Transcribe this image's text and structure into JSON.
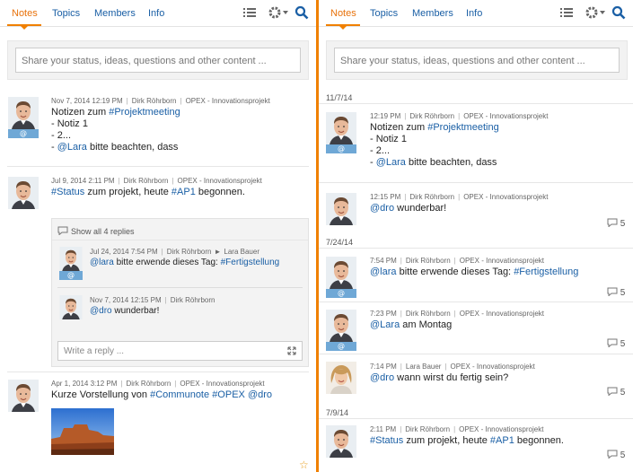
{
  "tabs": [
    "Notes",
    "Topics",
    "Members",
    "Info"
  ],
  "share_placeholder": "Share your status, ideas, questions and other content ...",
  "colors": {
    "accent": "#f08000",
    "link": "#1a5fa5",
    "badge": "#6fa8d6"
  },
  "left": {
    "posts": [
      {
        "date": "Nov 7, 2014 12:19 PM",
        "author": "Dirk Röhrborn",
        "project": "OPEX - Innovationsprojekt",
        "line1_pre": "Notizen zum ",
        "line1_tag": "#Projektmeeting",
        "line2": "- Notiz 1",
        "line3": "- 2...",
        "line4_pre": "- ",
        "line4_mention": "@Lara",
        "line4_post": " bitte beachten, dass",
        "badge": "@"
      },
      {
        "date": "Jul 9, 2014 2:11 PM",
        "author": "Dirk Röhrborn",
        "project": "OPEX - Innovationsprojekt",
        "line1_tag1": "#Status",
        "line1_mid": " zum projekt, heute ",
        "line1_tag2": "#AP1",
        "line1_post": " begonnen."
      },
      {
        "date": "Apr 1, 2014 3:12 PM",
        "author": "Dirk Röhrborn",
        "project": "OPEX - Innovationsprojekt",
        "line1_pre": "Kurze Vorstellung von ",
        "line1_tag1": "#Communote",
        "line1_tag2": "#OPEX",
        "line1_mention": "@dro"
      }
    ],
    "replies": {
      "show_all": "Show all 4 replies",
      "items": [
        {
          "date": "Jul 24, 2014 7:54 PM",
          "author": "Dirk Röhrborn",
          "arrow": "►",
          "to": "Lara Bauer",
          "mention": "@lara",
          "text": " bitte erwende dieses Tag: ",
          "tag": "#Fertigstellung",
          "badge": "@"
        },
        {
          "date": "Nov 7, 2014 12:15 PM",
          "author": "Dirk Röhrborn",
          "mention": "@dro",
          "text": " wunderbar!"
        }
      ],
      "write_placeholder": "Write a reply ..."
    }
  },
  "right": {
    "groups": [
      {
        "date": "11/7/14",
        "items": [
          {
            "time": "12:19 PM",
            "author": "Dirk Röhrborn",
            "project": "OPEX - Innovationsprojekt",
            "l1_pre": "Notizen zum ",
            "l1_tag": "#Projektmeeting",
            "l2": "- Notiz 1",
            "l3": "- 2...",
            "l4_pre": "- ",
            "l4_mention": "@Lara",
            "l4_post": " bitte beachten, dass",
            "badge": "@"
          },
          {
            "time": "12:15 PM",
            "author": "Dirk Röhrborn",
            "project": "OPEX - Innovationsprojekt",
            "mention": "@dro",
            "text": " wunderbar!",
            "count": "5"
          }
        ]
      },
      {
        "date": "7/24/14",
        "items": [
          {
            "time": "7:54 PM",
            "author": "Dirk Röhrborn",
            "project": "OPEX - Innovationsprojekt",
            "mention": "@lara",
            "text": " bitte erwende dieses Tag: ",
            "tag": "#Fertigstellung",
            "count": "5",
            "badge": "@"
          },
          {
            "time": "7:23 PM",
            "author": "Dirk Röhrborn",
            "project": "OPEX - Innovationsprojekt",
            "mention": "@Lara",
            "text": " am Montag",
            "count": "5",
            "badge": "@"
          },
          {
            "time": "7:14 PM",
            "author": "Lara Bauer",
            "project": "OPEX - Innovationsprojekt",
            "mention": "@dro",
            "text": " wann wirst du fertig sein?",
            "count": "5"
          }
        ]
      },
      {
        "date": "7/9/14",
        "items": [
          {
            "time": "2:11 PM",
            "author": "Dirk Röhrborn",
            "project": "OPEX - Innovationsprojekt",
            "tag1": "#Status",
            "mid": " zum projekt, heute ",
            "tag2": "#AP1",
            "post": " begonnen.",
            "count": "5"
          }
        ]
      }
    ]
  }
}
